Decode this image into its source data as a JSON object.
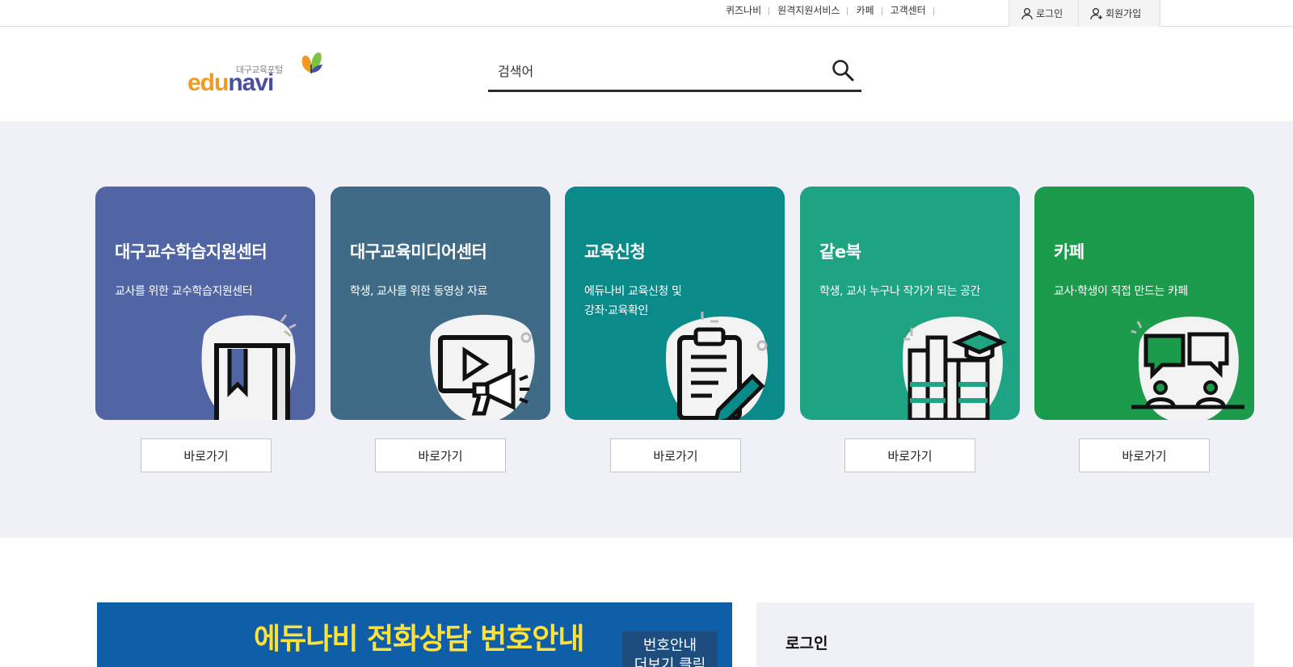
{
  "topbar": {
    "links": [
      "퀴즈나비",
      "원격지원서비스",
      "카페",
      "고객센터"
    ],
    "login_label": "로그인",
    "join_label": "회원가입"
  },
  "header": {
    "logo_sub": "대구교육포털",
    "logo_main": "edunavi",
    "search_placeholder": "검색어"
  },
  "cards": [
    {
      "title": "대구교수학습지원센터",
      "desc": "교사를 위한 교수학습지원센터",
      "button": "바로가기",
      "color": "#5165a5",
      "icon": "book-icon"
    },
    {
      "title": "대구교육미디어센터",
      "desc": "학생, 교사를 위한 동영상 자료",
      "button": "바로가기",
      "color": "#3f6b87",
      "icon": "video-megaphone-icon"
    },
    {
      "title": "교육신청",
      "desc": "에듀나비 교육신청 및\n강좌·교육확인",
      "button": "바로가기",
      "color": "#0b8a8a",
      "icon": "clipboard-pencil-icon"
    },
    {
      "title": "같e북",
      "desc": "학생, 교사 누구나 작가가 되는 공간",
      "button": "바로가기",
      "color": "#1ea383",
      "icon": "books-graduation-icon"
    },
    {
      "title": "카페",
      "desc": "교사·학생이 직접 만드는 카페",
      "button": "바로가기",
      "color": "#1c9b4d",
      "icon": "chat-people-icon"
    }
  ],
  "banner": {
    "title": "에듀나비 전화상담 번호안내",
    "box_text": "번호안내\n더보기 클릭"
  },
  "login_panel": {
    "title": "로그인"
  }
}
